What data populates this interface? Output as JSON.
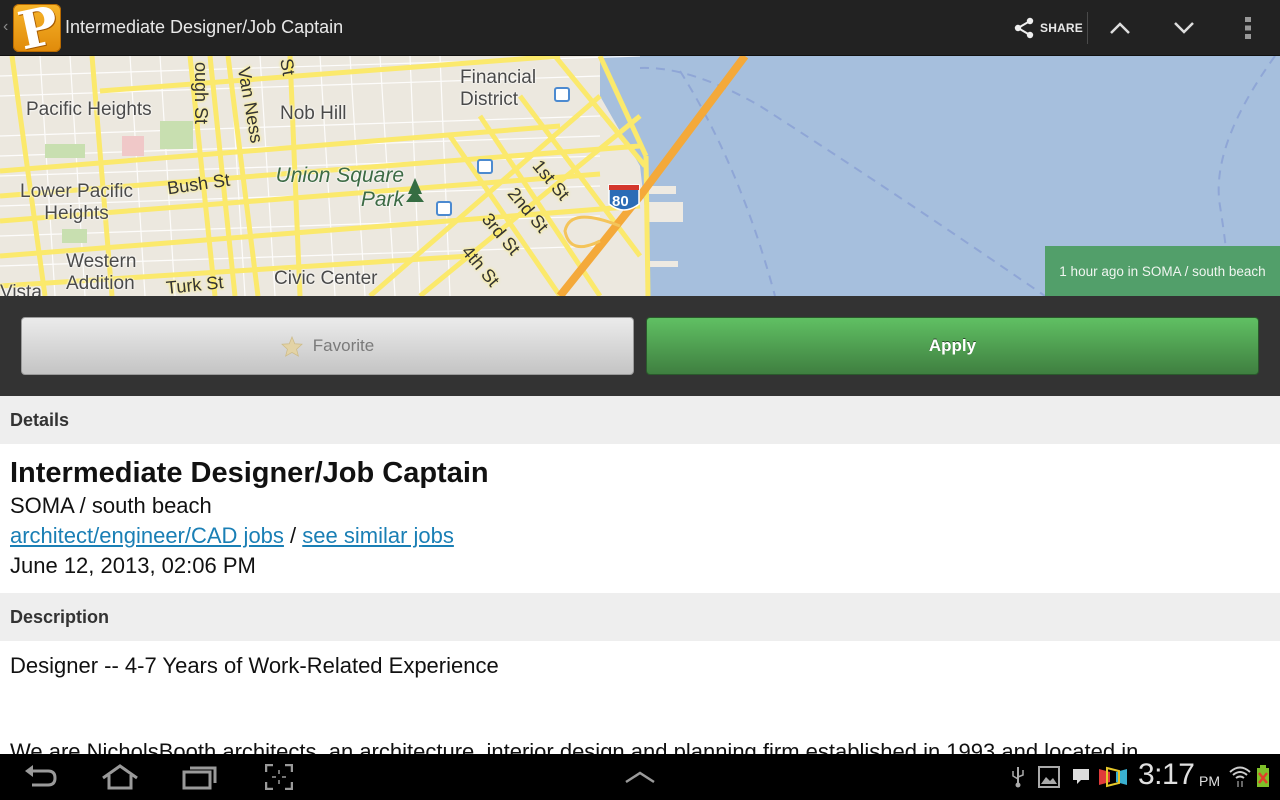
{
  "action_bar": {
    "app_icon": "craigslist-p-logo",
    "title": "Intermediate Designer/Job Captain",
    "share_label": "SHARE",
    "icons": [
      "share-icon",
      "chevron-up-icon",
      "chevron-down-icon",
      "overflow-menu-icon"
    ]
  },
  "map": {
    "labels": {
      "pacific_heights": "Pacific Heights",
      "lower_pacific_heights": "Lower Pacific Heights",
      "western_addition": "Western Addition",
      "vista": "Vista",
      "nob_hill": "Nob Hill",
      "financial_district": "Financial District",
      "union_square_park": "Union Square Park",
      "civic_center": "Civic Center",
      "gough_st": "ough St",
      "van_ness": "Van Ness",
      "bush_st": "Bush St",
      "turk_st": "Turk St",
      "st_top": "St",
      "first_st": "1st St",
      "second_st": "2nd St",
      "third_st": "3rd St",
      "fourth_st": "4th St",
      "interstate": "80"
    },
    "posted_badge": "1 hour ago in SOMA / south beach",
    "colors": {
      "water": "#a6bfdd",
      "land": "#ece8df",
      "road": "#fbe96c",
      "highway": "#f4a93a",
      "badge": "#529f6a"
    }
  },
  "buttons": {
    "favorite_label": "Favorite",
    "apply_label": "Apply",
    "apply_color": "#4f9f50"
  },
  "details": {
    "section_label": "Details",
    "title": "Intermediate Designer/Job Captain",
    "location": "SOMA / south beach",
    "category_link": "architect/engineer/CAD jobs",
    "separator": " / ",
    "similar_link": "see similar jobs",
    "posted_date": "June 12, 2013, 02:06 PM",
    "link_color": "#1a7fb5"
  },
  "description": {
    "section_label": "Description",
    "headline": "Designer -- 4-7 Years of Work-Related Experience",
    "body_partial": "We are NicholsBooth architects, an architecture, interior design and planning firm established in 1993 and located in"
  },
  "system_bar": {
    "nav_icons": [
      "back-icon",
      "home-icon",
      "recent-apps-icon",
      "screenshot-icon",
      "menu-up-icon"
    ],
    "status_icons": [
      "usb-icon",
      "gallery-icon",
      "message-icon",
      "flipboard-icon",
      "wifi-icon",
      "battery-icon"
    ],
    "time": "3:17",
    "ampm": "PM"
  }
}
